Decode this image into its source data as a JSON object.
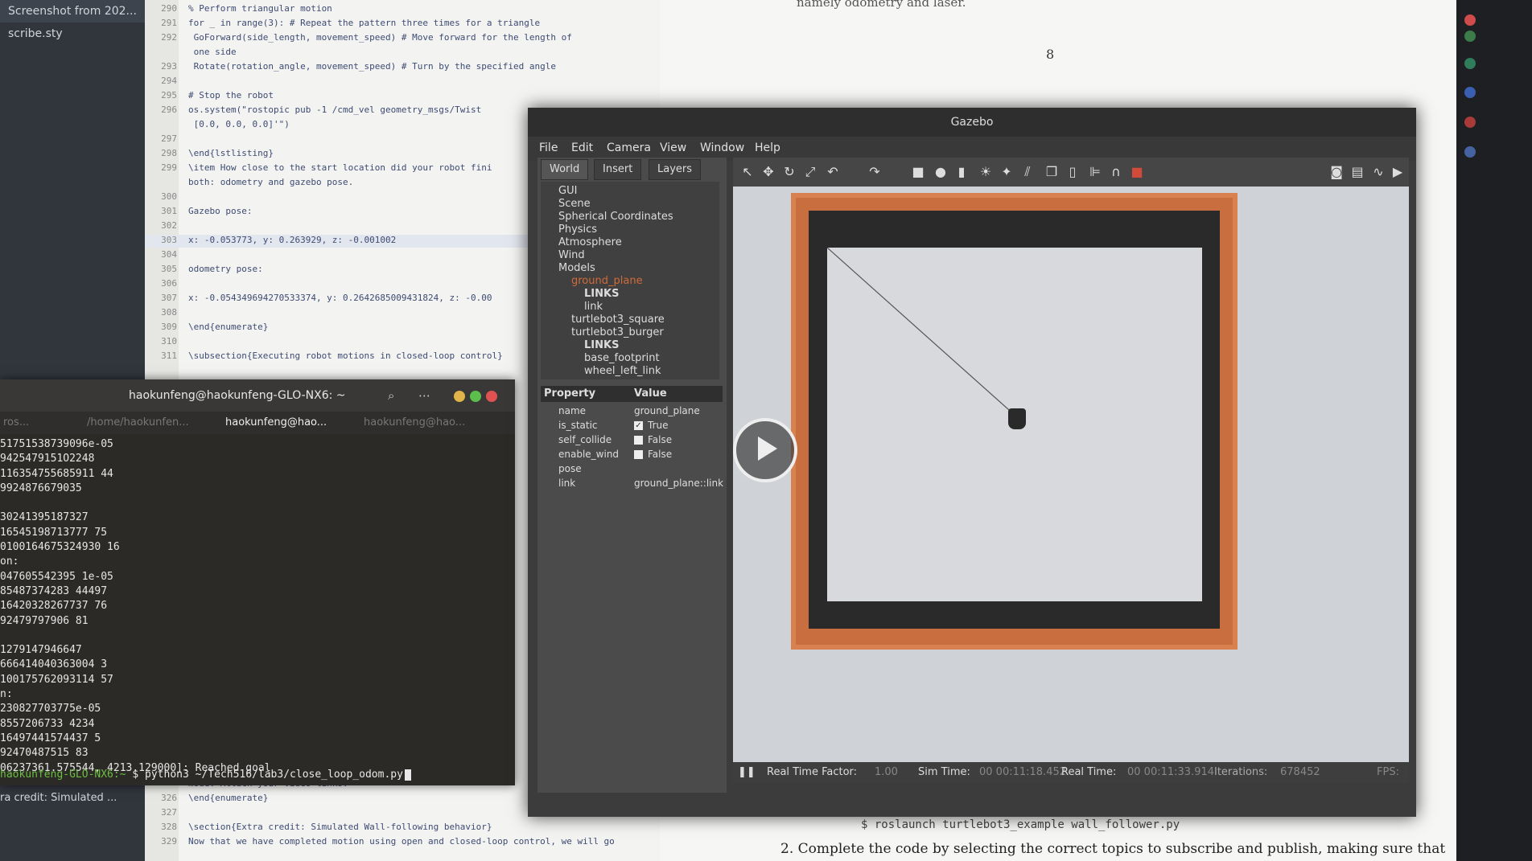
{
  "file_sidebar": {
    "items": [
      "Screenshot from 202...",
      "scribe.sty"
    ]
  },
  "editor": {
    "lines": [
      {
        "n": "290",
        "t": "% Perform triangular motion"
      },
      {
        "n": "291",
        "t": "for _ in range(3):  # Repeat the pattern three times for a triangle"
      },
      {
        "n": "292",
        "t": "    GoForward(side_length, movement_speed)  # Move forward for the length of"
      },
      {
        "n": "",
        "t": "    one side"
      },
      {
        "n": "293",
        "t": "    Rotate(rotation_angle, movement_speed)  # Turn by the specified angle"
      },
      {
        "n": "294",
        "t": ""
      },
      {
        "n": "295",
        "t": "# Stop the robot"
      },
      {
        "n": "296",
        "t": "os.system(\"rostopic pub -1 /cmd_vel geometry_msgs/Twist"
      },
      {
        "n": "",
        "t": "  [0.0, 0.0, 0.0]'\")"
      },
      {
        "n": "297",
        "t": ""
      },
      {
        "n": "298",
        "t": "\\end{lstlisting}"
      },
      {
        "n": "299",
        "t": "\\item How close to the start location did your robot fini"
      },
      {
        "n": "",
        "t": "both: odometry and gazebo pose."
      },
      {
        "n": "300",
        "t": ""
      },
      {
        "n": "301",
        "t": "Gazebo pose:"
      },
      {
        "n": "302",
        "t": ""
      },
      {
        "n": "303",
        "t": "x: -0.053773, y: 0.263929, z: -0.001002"
      },
      {
        "n": "304",
        "t": ""
      },
      {
        "n": "305",
        "t": "odometry pose:"
      },
      {
        "n": "306",
        "t": ""
      },
      {
        "n": "307",
        "t": "x: -0.054349694270533374, y: 0.2642685009431824, z: -0.00"
      },
      {
        "n": "308",
        "t": ""
      },
      {
        "n": "309",
        "t": "\\end{enumerate}"
      },
      {
        "n": "310",
        "t": ""
      },
      {
        "n": "311",
        "t": "\\subsection{Executing robot motions in closed-loop control}"
      }
    ],
    "bottom_lines": [
      {
        "n": "",
        "t": "mode. Attach your video links."
      },
      {
        "n": "326",
        "t": "\\end{enumerate}"
      },
      {
        "n": "327",
        "t": ""
      },
      {
        "n": "328",
        "t": "\\section{Extra credit: Simulated Wall-following behavior}"
      },
      {
        "n": "329",
        "t": "Now that we have completed motion using open and closed-loop control, we will go"
      }
    ]
  },
  "pdf": {
    "top_text": "namely odometry and laser.",
    "page_number": "8",
    "bottom_code": "$ roslaunch turtlebot3_example wall_follower.py",
    "bottom_text": "2.  Complete the code by selecting the correct topics to subscribe and publish, making sure that"
  },
  "terminal": {
    "title": "haokunfeng@haokunfeng-GLO-NX6: ~",
    "tabs": [
      "ros...",
      "/home/haokunfen...",
      "haokunfeng@hao...",
      "haokunfeng@hao..."
    ],
    "output": "51751538739096e-05\n9425479151O2248\n116354755685911 44\n9924876679035\n\n30241395187327\n16545198713777 75\n0100164675324930 16\non:\n047605542395 1e-05\n85487374283 44497\n16420328267737 76\n92479797906 81\n\n1279147946647\n666414040363004 3\n100175762093114 57\nn:\n230827703775e-05\n8557206733 4234\n16497441574437 5\n92470487515 83\n06237361.575544, 4213.129000]: Reached goal",
    "prompt_user": "haokunfeng-GLO-NX6:~",
    "prompt_cmd": "$ python3 ~/Tech516/lab3/close_loop_odom.py",
    "under_text": "ra credit: Simulated ..."
  },
  "gazebo": {
    "title": "Gazebo",
    "menu": [
      "File",
      "Edit",
      "Camera",
      "View",
      "Window",
      "Help"
    ],
    "tabs": [
      "World",
      "Insert",
      "Layers"
    ],
    "tree": [
      {
        "label": "GUI",
        "indent": 0
      },
      {
        "label": "Scene",
        "indent": 0
      },
      {
        "label": "Spherical Coordinates",
        "indent": 0
      },
      {
        "label": "Physics",
        "indent": 0
      },
      {
        "label": "Atmosphere",
        "indent": 0
      },
      {
        "label": "Wind",
        "indent": 0
      },
      {
        "label": "Models",
        "indent": 0
      },
      {
        "label": "ground_plane",
        "indent": 1
      },
      {
        "label": "LINKS",
        "indent": 2
      },
      {
        "label": "link",
        "indent": 2
      },
      {
        "label": "turtlebot3_square",
        "indent": 1
      },
      {
        "label": "turtlebot3_burger",
        "indent": 1
      },
      {
        "label": "LINKS",
        "indent": 2
      },
      {
        "label": "base_footprint",
        "indent": 2
      },
      {
        "label": "wheel_left_link",
        "indent": 2
      }
    ],
    "property_header": {
      "property": "Property",
      "value": "Value"
    },
    "properties": [
      {
        "key": "name",
        "value": "ground_plane"
      },
      {
        "key": "is_static",
        "value": "True",
        "checked": true
      },
      {
        "key": "self_collide",
        "value": "False",
        "checked": false
      },
      {
        "key": "enable_wind",
        "value": "False",
        "checked": false
      },
      {
        "key": "pose",
        "value": ""
      },
      {
        "key": "link",
        "value": "ground_plane::link"
      }
    ],
    "status": {
      "rtf_label": "Real Time Factor:",
      "rtf_value": "1.00",
      "sim_label": "Sim Time:",
      "sim_value": "00 00:11:18.452",
      "real_label": "Real Time:",
      "real_value": "00 00:11:33.914",
      "iter_label": "Iterations:",
      "iter_value": "678452",
      "fps_label": "FPS:"
    },
    "colors": {
      "wall": "#c96f3f",
      "floor": "#d8d9dc",
      "robot": "#2a2a2a"
    }
  }
}
